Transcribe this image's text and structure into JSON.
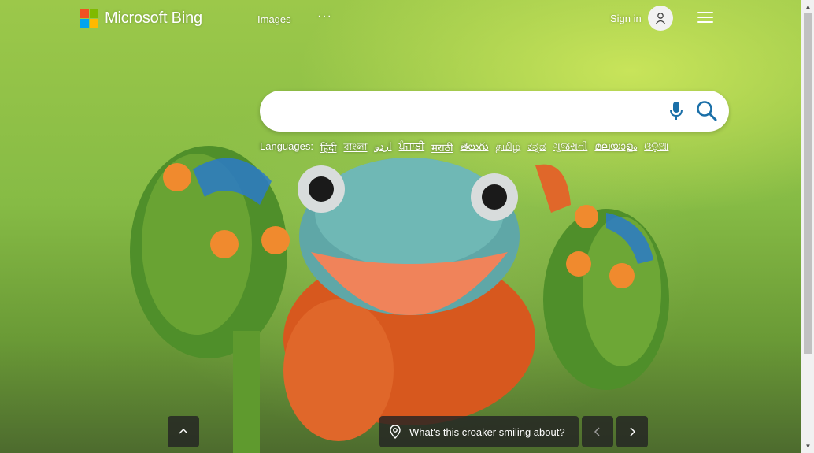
{
  "header": {
    "brand": "Microsoft Bing",
    "nav_images": "Images",
    "nav_more": "···",
    "signin": "Sign in"
  },
  "search": {
    "value": "",
    "placeholder": ""
  },
  "languages": {
    "label": "Languages:",
    "items": [
      "हिंदी",
      "বাংলা",
      "اردو",
      "ਪੰਜਾਬੀ",
      "मराठी",
      "తెలుగు",
      "தமிழ்",
      "ಕನ್ನಡ",
      "ગુજરાતી",
      "മലയാളം",
      "ଓଡ଼ିଆ"
    ]
  },
  "footer": {
    "image_caption": "What's this croaker smiling about?"
  },
  "icons": {
    "logo": "microsoft-logo-icon",
    "avatar": "user-icon",
    "menu": "hamburger-menu-icon",
    "mic": "microphone-icon",
    "search": "search-icon",
    "location": "location-pin-icon",
    "up": "chevron-up-icon",
    "prev": "chevron-left-icon",
    "next": "chevron-right-icon"
  },
  "colors": {
    "accent": "#0078d4",
    "bar_bg": "#232323"
  }
}
